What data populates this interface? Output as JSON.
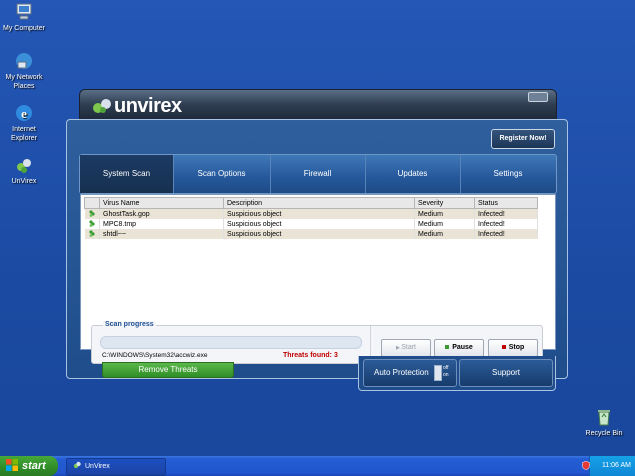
{
  "desktop": {
    "icons": [
      {
        "label": "My Computer",
        "icon": "computer-icon"
      },
      {
        "label": "My Network Places",
        "icon": "network-icon"
      },
      {
        "label": "Internet Explorer",
        "icon": "internet-explorer-icon"
      },
      {
        "label": "UnVirex",
        "icon": "unvirex-icon"
      },
      {
        "label": "Recycle Bin",
        "icon": "recycle-bin-icon"
      }
    ]
  },
  "app": {
    "logo_text": "unvirex",
    "register_label": "Register Now!",
    "tabs": [
      "System Scan",
      "Scan Options",
      "Firewall",
      "Updates",
      "Settings"
    ],
    "active_tab": "System Scan",
    "table": {
      "headers": [
        "Virus Name",
        "Description",
        "Severity",
        "Status"
      ],
      "rows": [
        {
          "name": "GhostTask.gop",
          "description": "Suspicious object",
          "severity": "Medium",
          "status": "Infected!"
        },
        {
          "name": "MPC8.tmp",
          "description": "Suspicious object",
          "severity": "Medium",
          "status": "Infected!"
        },
        {
          "name": "shtdl~~",
          "description": "Suspicious object",
          "severity": "Medium",
          "status": "Infected!"
        }
      ]
    },
    "scan": {
      "label": "Scan progress",
      "progress": 0.0,
      "current_path": "C:\\WINDOWS\\System32\\accwiz.exe",
      "threats_text": "Threats found: 3"
    },
    "buttons": {
      "start": "Start",
      "pause": "Pause",
      "stop": "Stop",
      "remove": "Remove Threats"
    },
    "auto_protection": {
      "label": "Auto Protection",
      "off": "off",
      "on": "on"
    },
    "support_label": "Support"
  },
  "taskbar": {
    "start_label": "start",
    "task_item": "UnVirex",
    "clock": "11:06 AM"
  },
  "colors": {
    "desktop": "#1f4fa8",
    "threats": "#c00000",
    "remove_button": "#3a9a30"
  }
}
